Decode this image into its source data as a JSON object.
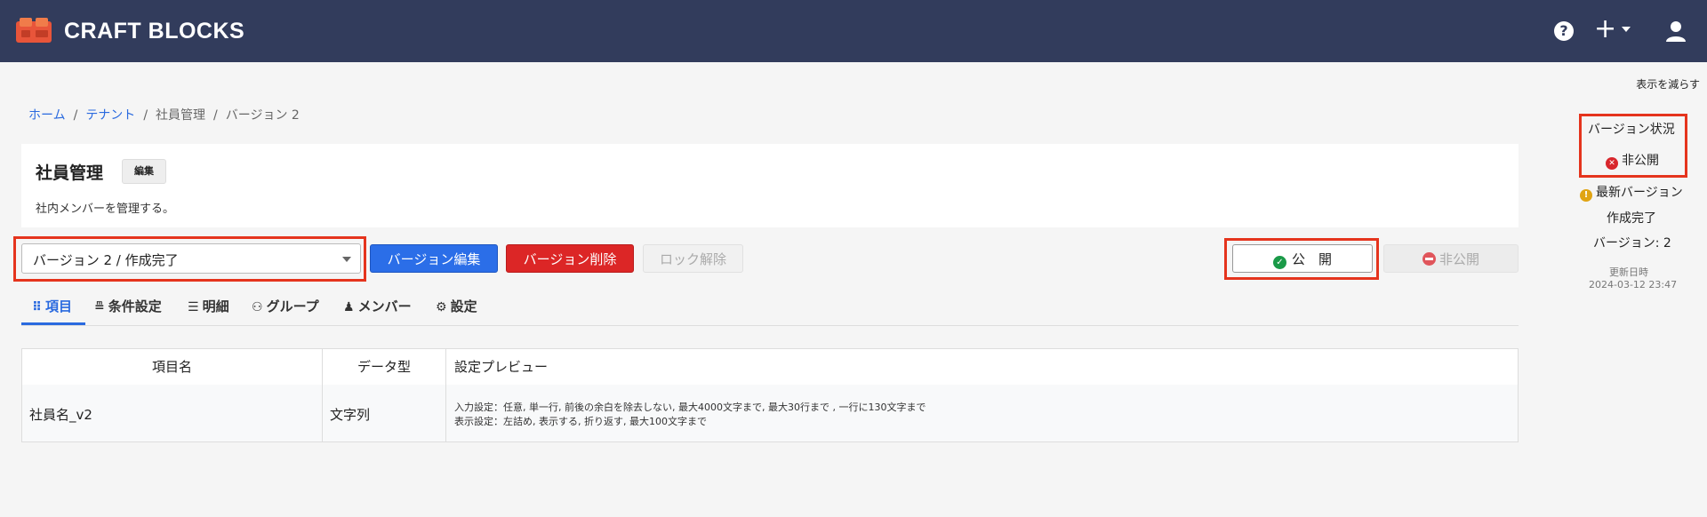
{
  "app": {
    "brand": "CRAFT BLOCKS"
  },
  "header_icons": {
    "help": "?",
    "plus": "+"
  },
  "hide_label": "表示を減らす",
  "breadcrumb": {
    "items": [
      "ホーム",
      "テナント",
      "社員管理",
      "バージョン 2"
    ],
    "separator": "/"
  },
  "page": {
    "title": "社員管理",
    "edit_label": "編集",
    "description": "社内メンバーを管理する。"
  },
  "version_select": {
    "value": "バージョン 2 / 作成完了"
  },
  "actions": {
    "edit_version": "バージョン編集",
    "delete_version": "バージョン削除",
    "unlock": "ロック解除",
    "publish": "公　開",
    "unpublish": "非公開"
  },
  "tabs": [
    {
      "label": "項目",
      "icon": "grid-icon"
    },
    {
      "label": "条件設定",
      "icon": "filter-user-icon"
    },
    {
      "label": "明細",
      "icon": "list-icon"
    },
    {
      "label": "グループ",
      "icon": "group-icon"
    },
    {
      "label": "メンバー",
      "icon": "person-icon"
    },
    {
      "label": "設定",
      "icon": "gear-icon"
    }
  ],
  "table": {
    "headers": [
      "項目名",
      "データ型",
      "設定プレビュー"
    ],
    "rows": [
      {
        "name": "社員名_v2",
        "type": "文字列",
        "preview_line1": "入力設定：任意, 単一行, 前後の余白を除去しない, 最大4000文字まで, 最大30行まで , 一行に130文字まで",
        "preview_line2": "表示設定：左詰め, 表示する, 折り返す, 最大100文字まで"
      }
    ]
  },
  "side": {
    "title": "バージョン状況",
    "status": "非公開",
    "latest": "最新バージョン",
    "state": "作成完了",
    "version": "バージョン: 2",
    "updated_label": "更新日時",
    "updated": "2024-03-12 23:47"
  },
  "colors": {
    "topbar": "#323c5c",
    "primary": "#2b6ee8",
    "danger": "#dc2626",
    "highlight_frame": "#e5341d",
    "success": "#1a9a48"
  }
}
